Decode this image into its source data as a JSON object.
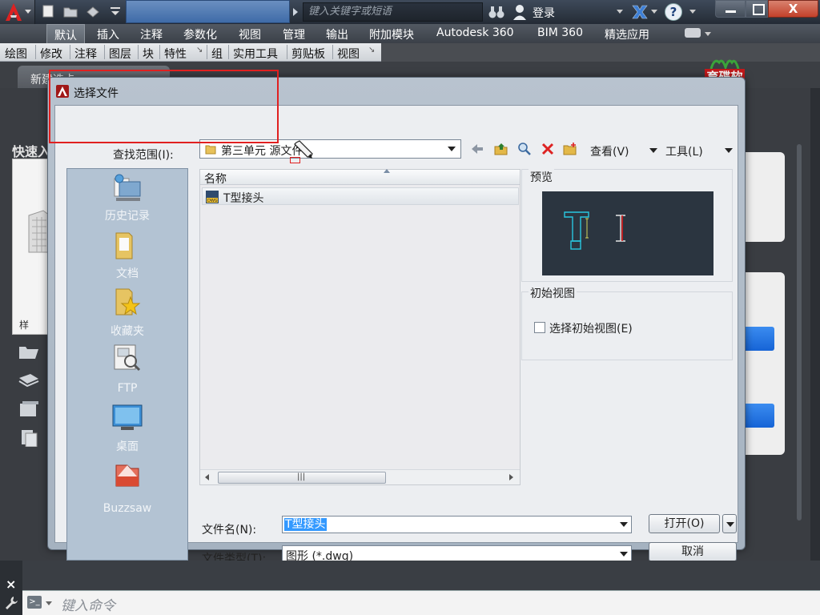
{
  "titlebar": {
    "search_placeholder": "键入关键字或短语",
    "login_label": "登录",
    "help_label": "?",
    "close_label": "X"
  },
  "ribbon": {
    "tabs": [
      "默认",
      "插入",
      "注释",
      "参数化",
      "视图",
      "管理",
      "输出",
      "附加模块",
      "Autodesk 360",
      "BIM 360",
      "精选应用"
    ]
  },
  "panels": [
    "绘图",
    "修改",
    "注释",
    "图层",
    "块",
    "特性",
    "组",
    "实用工具",
    "剪贴板",
    "视图"
  ],
  "file_tab": "新建选卡",
  "workspace": {
    "quick_label": "快速入",
    "thumb_label": "样"
  },
  "brand": {
    "text": "育碟软件"
  },
  "dialog": {
    "title": "选择文件",
    "lookin_label": "查找范围(I):",
    "lookin_value": "第三单元  源文件",
    "view_menu": "查看(V)",
    "tools_menu": "工具(L)",
    "places": [
      "历史记录",
      "文档",
      "收藏夹",
      "FTP",
      "桌面",
      "Buzzsaw"
    ],
    "column_name": "名称",
    "files": [
      {
        "name": "T型接头",
        "icon": "dwg-file-icon"
      }
    ],
    "preview_label": "预览",
    "initial_view_group": "初始视图",
    "initial_view_checkbox": "选择初始视图(E)",
    "initial_view_checked": false,
    "filename_label": "文件名(N):",
    "filename_value": "T型接头",
    "filetype_label": "文件类型(T):",
    "filetype_value": "图形 (*.dwg)",
    "open_button": "打开(O)",
    "cancel_button": "取消"
  },
  "command_line": {
    "placeholder": "键入命令"
  },
  "colors": {
    "accent_red": "#e02020",
    "selection_blue": "#3399ff",
    "brand_red": "#c5191b"
  }
}
